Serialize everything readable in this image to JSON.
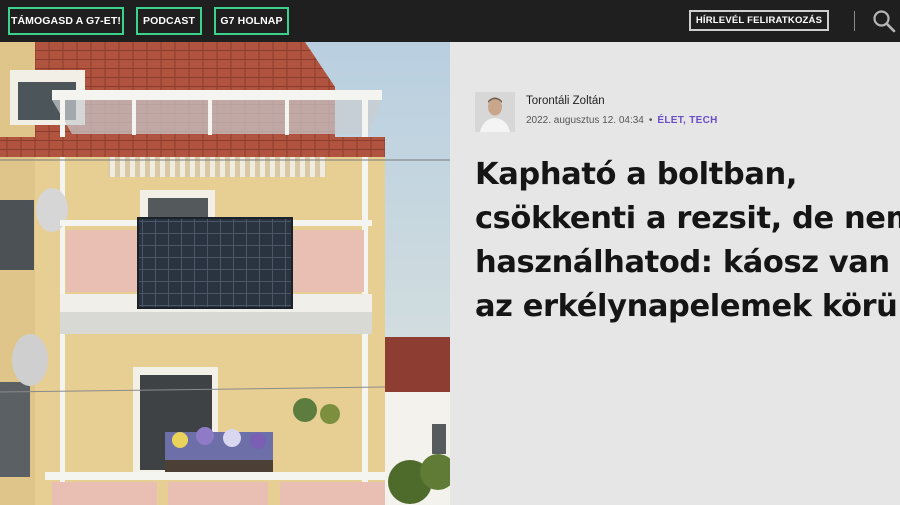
{
  "nav": {
    "support": "TÁMOGASD A G7-ET!",
    "podcast": "PODCAST",
    "holnap": "G7 HOLNAP",
    "newsletter": "HÍRLEVÉL FELIRATKOZÁS"
  },
  "icons": {
    "search": "search-icon",
    "avatar": "author-avatar"
  },
  "colors": {
    "accent_green": "#3ad28c",
    "category_purple": "#6a4fc7",
    "topbar": "#1f1f1f",
    "article_bg": "#e6e6e6"
  },
  "article": {
    "author": "Torontáli Zoltán",
    "date": "2022. augusztus 12. 04:34",
    "separator": "•",
    "category": "ÉLET, TECH",
    "title_lines": [
      "Kapható a boltban,",
      "csökkenti a rezsit, de nem",
      "használhatod: káosz van",
      "az erkélynapelemek körül"
    ]
  }
}
